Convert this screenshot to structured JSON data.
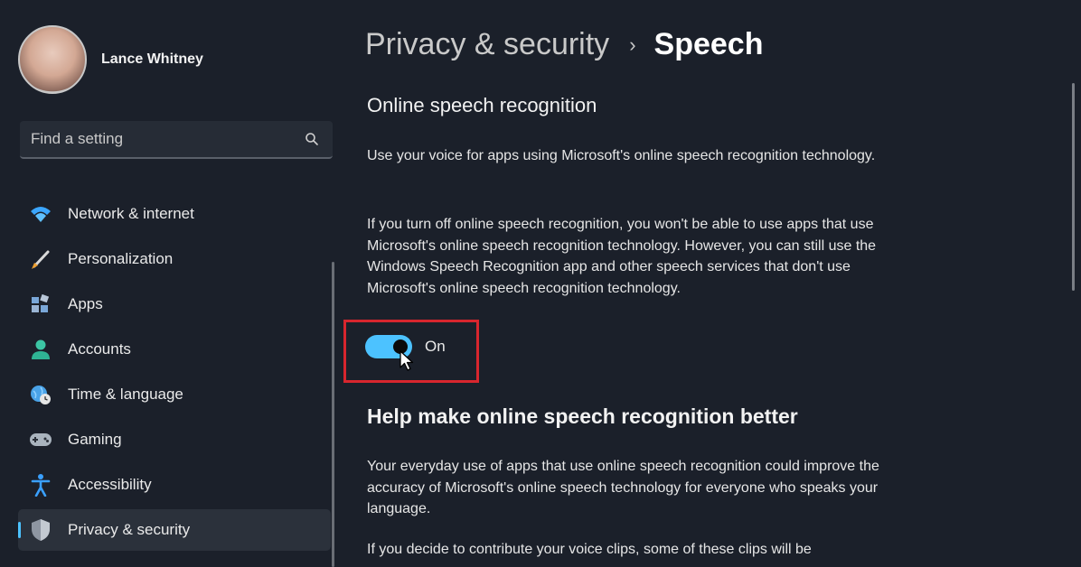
{
  "profile": {
    "name": "Lance Whitney"
  },
  "search": {
    "placeholder": "Find a setting",
    "icon": "search-icon"
  },
  "sidebar": {
    "items": [
      {
        "label": "Network & internet",
        "icon": "wifi-icon",
        "active": false
      },
      {
        "label": "Personalization",
        "icon": "paintbrush-icon",
        "active": false
      },
      {
        "label": "Apps",
        "icon": "apps-icon",
        "active": false
      },
      {
        "label": "Accounts",
        "icon": "person-icon",
        "active": false
      },
      {
        "label": "Time & language",
        "icon": "globe-clock-icon",
        "active": false
      },
      {
        "label": "Gaming",
        "icon": "gamepad-icon",
        "active": false
      },
      {
        "label": "Accessibility",
        "icon": "accessibility-icon",
        "active": false
      },
      {
        "label": "Privacy & security",
        "icon": "shield-icon",
        "active": true
      }
    ]
  },
  "header": {
    "parent": "Privacy & security",
    "separator": "›",
    "current": "Speech"
  },
  "main": {
    "section1_title": "Online speech recognition",
    "para1": "Use your voice for apps using Microsoft's online speech recognition technology.",
    "para2": "If you turn off online speech recognition, you won't be able to use apps that use Microsoft's online speech recognition technology.  However, you can still use the Windows Speech Recognition app and other speech services that don't use Microsoft's online speech recognition technology.",
    "toggle_label": "On",
    "toggle_on": true,
    "section2_title": "Help make online speech recognition better",
    "para3": "Your everyday use of apps that use online speech recognition could improve the accuracy of Microsoft's online speech technology for everyone who speaks your language.",
    "para4": "If you decide to contribute your voice clips, some of these clips will be"
  },
  "colors": {
    "accent": "#4cc2ff",
    "highlight_box": "#d8262e",
    "background": "#1b202a"
  }
}
